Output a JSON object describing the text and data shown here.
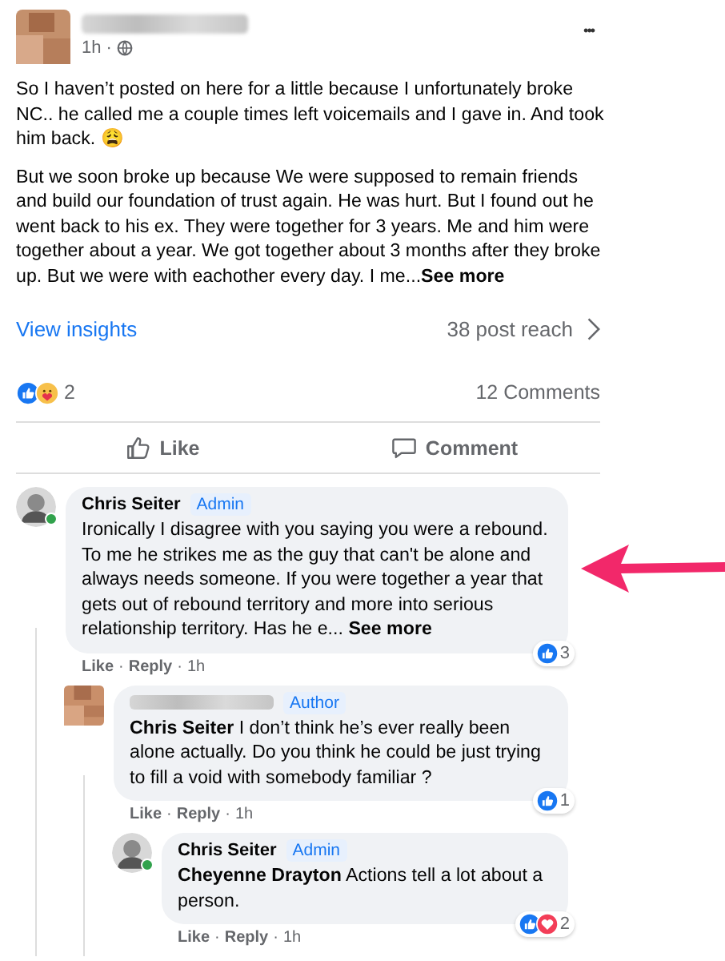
{
  "post": {
    "author_hidden": true,
    "time": "1h ·",
    "menu": "•••",
    "paragraphs": [
      "So I haven’t posted on here for a little because I unfortunately broke NC.. he called me a couple times left voicemails and I gave in. And took him back. 😩",
      "But we soon broke up because We were supposed to remain friends and build our foundation of trust again. He was hurt. But I found out he went back to his ex. They were together for 3 years. Me and him were together about a year. We got together about 3 months after they broke up. But we were with eachother every day. I me..."
    ],
    "see_more": "See more",
    "insights": "View insights",
    "reach": "38 post reach",
    "reactions": [
      {
        "kind": "like"
      },
      {
        "kind": "care"
      }
    ],
    "reaction_count": "2",
    "comments_count": "12 Comments",
    "actions": [
      {
        "kind": "like",
        "label": "Like"
      },
      {
        "kind": "comment",
        "label": "Comment"
      }
    ]
  },
  "comments": [
    {
      "author_hidden": false,
      "author": "Chris Seiter",
      "badge": "Admin",
      "online": true,
      "text": "Ironically I disagree with you saying you were a rebound. To me he strikes me as the guy that can't be alone and always needs someone. If you were together a year that gets out of rebound territory and more into serious relationship territory. Has he e...",
      "see_more": "See more",
      "links": [
        "Like",
        "Reply"
      ],
      "separator": "·",
      "time": "1h",
      "reactions": [
        {
          "kind": "like"
        }
      ],
      "reaction_count": "3",
      "children": [
        {
          "author_hidden": true,
          "badge": "Author",
          "online": false,
          "mention": "Chris Seiter",
          "text": "I don’t think he’s ever really been alone actually. Do you think he could be just trying to fill a void with somebody familiar ?",
          "links": [
            "Like",
            "Reply"
          ],
          "separator": "·",
          "time": "1h",
          "reactions": [
            {
              "kind": "like"
            }
          ],
          "reaction_count": "1",
          "children": [
            {
              "author_hidden": false,
              "author": "Chris Seiter",
              "badge": "Admin",
              "online": true,
              "mention": "Cheyenne Drayton",
              "text": "Actions tell a lot about a person.",
              "links": [
                "Like",
                "Reply"
              ],
              "separator": "·",
              "time": "1h",
              "reactions": [
                {
                  "kind": "like"
                },
                {
                  "kind": "love"
                }
              ],
              "reaction_count": "2"
            }
          ]
        }
      ]
    }
  ]
}
